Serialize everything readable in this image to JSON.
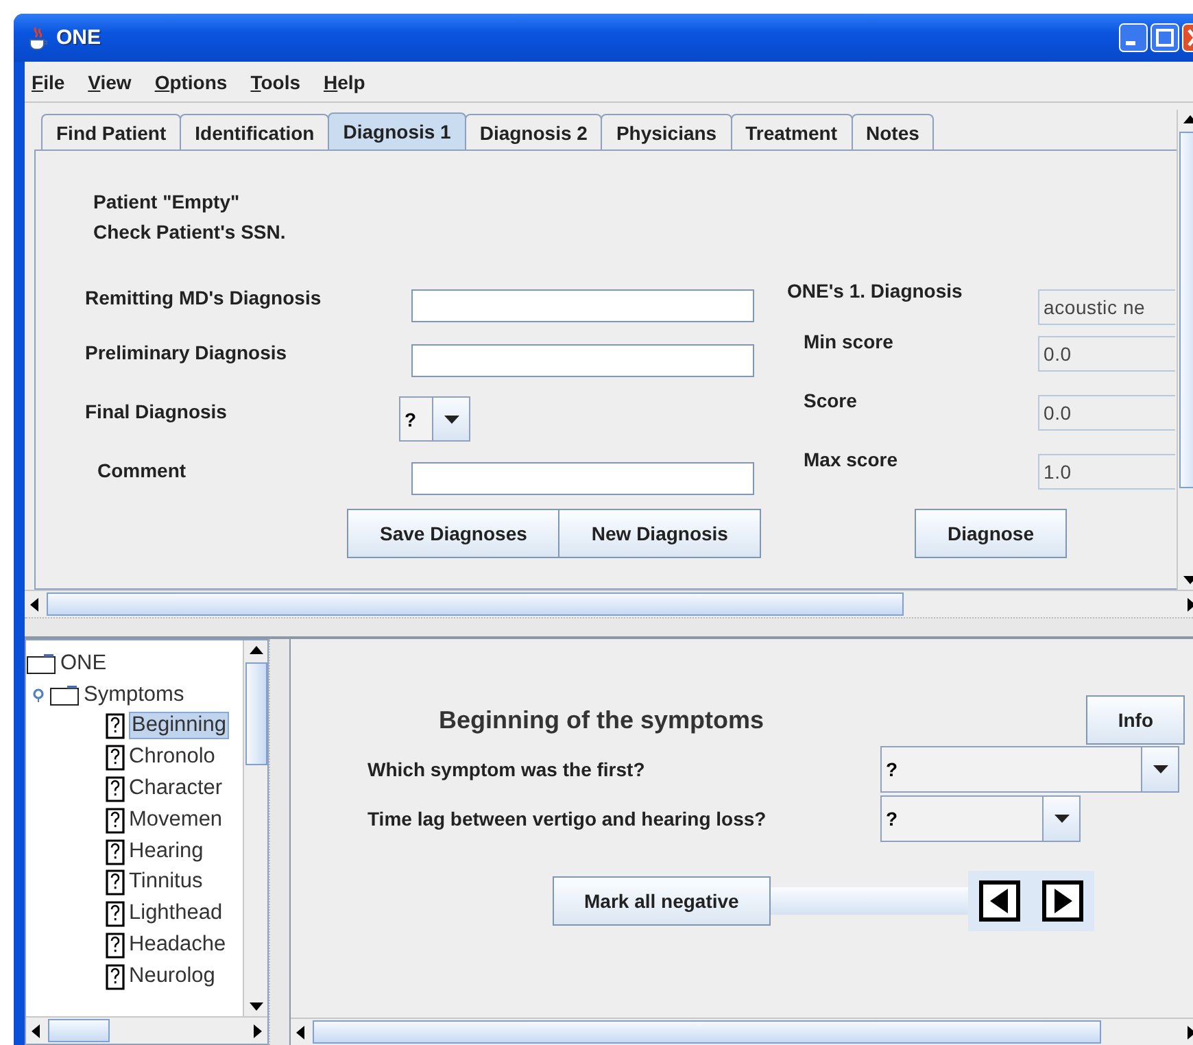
{
  "window": {
    "title": "ONE"
  },
  "menu": [
    "File",
    "View",
    "Options",
    "Tools",
    "Help"
  ],
  "tabs": [
    {
      "label": "Find Patient",
      "selected": false
    },
    {
      "label": "Identification",
      "selected": false
    },
    {
      "label": "Diagnosis 1",
      "selected": true
    },
    {
      "label": "Diagnosis 2",
      "selected": false
    },
    {
      "label": "Physicians",
      "selected": false
    },
    {
      "label": "Treatment",
      "selected": false
    },
    {
      "label": "Notes",
      "selected": false
    }
  ],
  "messages": [
    "Patient \"Empty\"",
    "Check Patient's SSN."
  ],
  "diagnosis_fields": [
    {
      "label": "Remitting MD's Diagnosis",
      "kind": "text"
    },
    {
      "label": "Preliminary Diagnosis",
      "kind": "text"
    },
    {
      "label": "Final Diagnosis",
      "kind": "combo",
      "value": "?"
    },
    {
      "label": "Comment",
      "kind": "text"
    }
  ],
  "results": [
    {
      "label": "ONE's 1. Diagnosis",
      "value": "acoustic ne"
    },
    {
      "label": "Min score",
      "value": "0.0"
    },
    {
      "label": "Score",
      "value": "0.0"
    },
    {
      "label": "Max score",
      "value": "1.0"
    }
  ],
  "buttons": [
    "Save Diagnoses",
    "New Diagnosis"
  ],
  "diagnose_button": "Diagnose",
  "tree": [
    {
      "label": "ONE",
      "children": [
        {
          "label": "Symptoms",
          "children": [
            {
              "label": "Beginning",
              "selected": true
            },
            {
              "label": "Chronolo",
              "selected": false
            },
            {
              "label": "Character",
              "selected": false
            },
            {
              "label": "Movemen",
              "selected": false
            },
            {
              "label": "Hearing",
              "selected": false
            },
            {
              "label": "Tinnitus",
              "selected": false
            },
            {
              "label": "Lighthead",
              "selected": false
            },
            {
              "label": "Headache",
              "selected": false
            },
            {
              "label": "Neurolog",
              "selected": false
            }
          ]
        }
      ]
    }
  ],
  "detail": {
    "title": "Beginning of the symptoms",
    "info_button": "Info",
    "questions": [
      {
        "label": "Which symptom was the first?",
        "value": "?"
      },
      {
        "label": "Time lag between vertigo and hearing loss?",
        "value": "?"
      }
    ],
    "mark_button": "Mark all negative"
  }
}
